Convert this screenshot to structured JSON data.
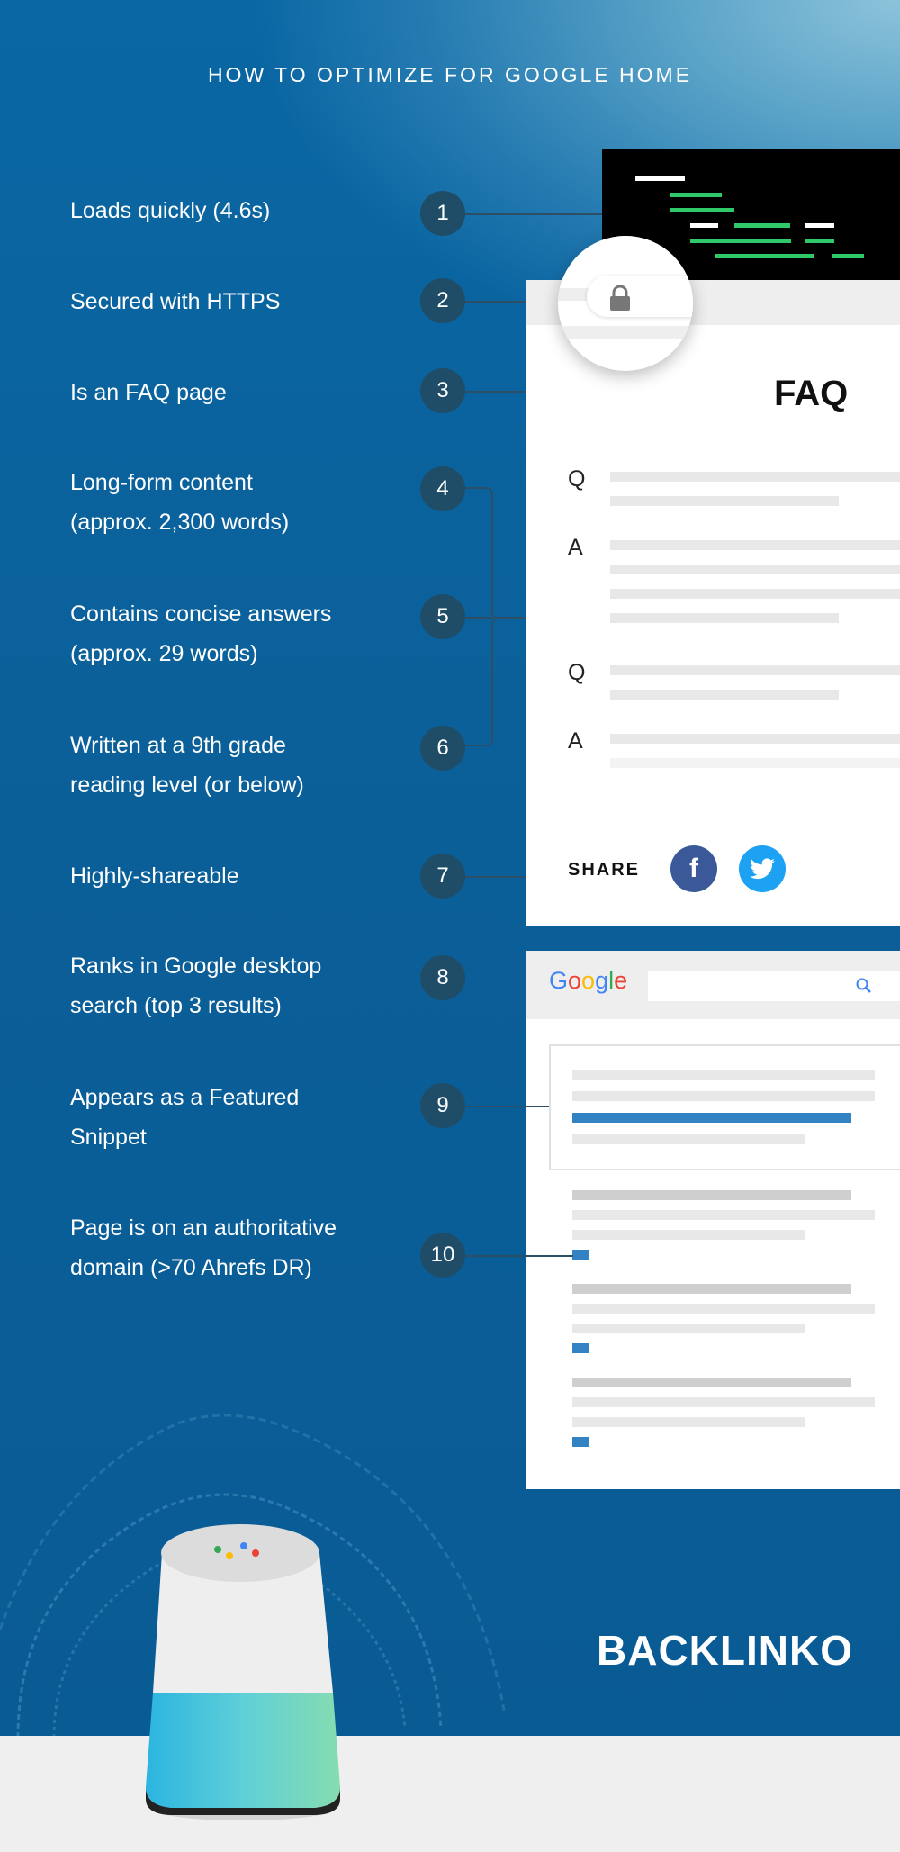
{
  "title": "HOW TO OPTIMIZE FOR GOOGLE HOME",
  "items": [
    {
      "number": "1",
      "text": "Loads quickly (4.6s)"
    },
    {
      "number": "2",
      "text": "Secured with HTTPS"
    },
    {
      "number": "3",
      "text": "Is an FAQ page"
    },
    {
      "number": "4",
      "text": "Long-form content\n(approx. 2,300 words)"
    },
    {
      "number": "5",
      "text": "Contains concise answers\n(approx. 29 words)"
    },
    {
      "number": "6",
      "text": "Written at a 9th grade\nreading level (or below)"
    },
    {
      "number": "7",
      "text": "Highly-shareable"
    },
    {
      "number": "8",
      "text": "Ranks in Google desktop\nsearch (top 3 results)"
    },
    {
      "number": "9",
      "text": "Appears as a Featured\nSnippet"
    },
    {
      "number": "10",
      "text": "Page is on an authoritative\ndomain (>70 Ahrefs DR)"
    }
  ],
  "faq_card": {
    "heading": "FAQ",
    "q1": "Q",
    "a1": "A",
    "q2": "Q",
    "a2": "A",
    "share_label": "SHARE",
    "facebook_glyph": "f"
  },
  "search_card": {
    "logo": [
      "G",
      "o",
      "o",
      "g",
      "l",
      "e"
    ]
  },
  "brand": "BACKLINKO",
  "colors": {
    "background": "#0a5d97",
    "circle": "#1f4d68",
    "terminal_green": "#2fc96a",
    "facebook": "#3b5998",
    "twitter": "#1da1f2",
    "snippet_blue": "#3282c4"
  },
  "icons": [
    "lock-icon",
    "facebook-icon",
    "twitter-icon",
    "search-icon",
    "google-home-device"
  ]
}
